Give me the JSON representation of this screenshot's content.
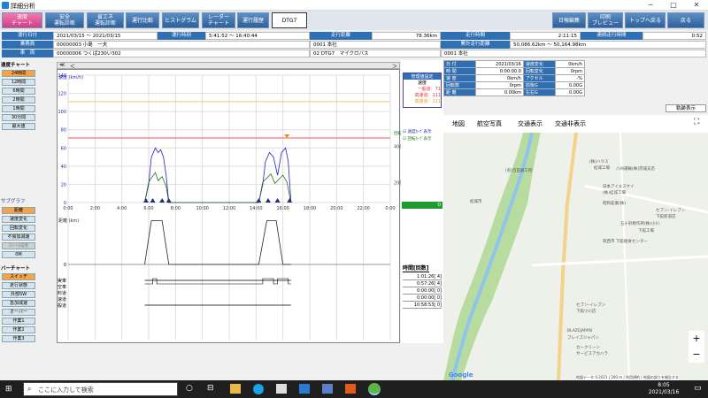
{
  "window": {
    "title": "詳細分析",
    "min": "─",
    "max": "□",
    "close": "✕"
  },
  "toolbar": {
    "left": [
      {
        "label": "速度\nチャート",
        "key": "speed"
      },
      {
        "label": "安全\n運転診断",
        "key": "safety"
      },
      {
        "label": "省エネ\n運転診断",
        "key": "eco"
      },
      {
        "label": "運行比較",
        "key": "compare"
      },
      {
        "label": "ヒストグラム",
        "key": "hist"
      },
      {
        "label": "レーダー\nチャート",
        "key": "radar"
      },
      {
        "label": "運行履歴",
        "key": "history"
      },
      {
        "label": "DTG7",
        "key": "dtg7"
      }
    ],
    "right": [
      {
        "label": "日報編集"
      },
      {
        "label": "印刷\nプレビュー"
      },
      {
        "label": "トップへ戻る"
      },
      {
        "label": "戻る"
      }
    ]
  },
  "info": {
    "rows": [
      {
        "l1": "運行日付",
        "v1": "2021/03/15 ～ 2021/03/15",
        "l2": "運行時刻",
        "v2": "5:41:52 ～ 16:40:44",
        "l3": "走行距離",
        "v3": "78.36km",
        "l4": "走行時間",
        "v4": "2:11:15",
        "l5": "連続走行時間",
        "v5": "0:52"
      },
      {
        "l1": "乗務員",
        "v1": "00000003 小島　一夫",
        "v2": "0001 本社",
        "l4": "累計走行距離",
        "v4": "50,086.62km ～ 50,164.98km"
      },
      {
        "l1": "車　両",
        "v1": "00000006 つくば230い302",
        "v2": "02 DTG7　マイクロバス",
        "v4": "0001 本社"
      }
    ]
  },
  "side": {
    "header1": "速度チャート",
    "items1": [
      "24時間",
      "12時間",
      "6時間",
      "2時間",
      "1時間",
      "30分間",
      "最大値"
    ],
    "header2": "サブグラフ",
    "items2": [
      "距離",
      "速度変化",
      "回転変化",
      "不良加減速",
      "ｽﾛｯﾄﾙ開度",
      "0M"
    ],
    "header3": "バーチャート",
    "items3": [
      "スイッチ",
      "走行状態",
      "外部SW",
      "急加減速",
      "オーバー",
      "作業1",
      "作業2",
      "作業3"
    ]
  },
  "chart_header": {
    "left1": "≪",
    "left2": "＜",
    "right": "＞"
  },
  "chart_data": {
    "type": "line",
    "title": "",
    "ylabel": "速度\n(km/h)",
    "yticks": [
      "140",
      "120",
      "100",
      "80",
      "60",
      "40",
      "20",
      "0"
    ],
    "ylim": [
      0,
      140
    ],
    "y2label": "回転数\n(rpm)",
    "y2ticks": [
      "4000",
      "2000"
    ],
    "xticks": [
      "0:00",
      "2:00",
      "4:00",
      "6:00",
      "8:00",
      "10:00",
      "12:00",
      "14:00",
      "16:00",
      "18:00",
      "20:00",
      "22:00",
      "0:00"
    ],
    "limit_lines": [
      {
        "name": "高速道",
        "value": 111,
        "color": "#f2c870"
      },
      {
        "name": "一般道",
        "value": 71,
        "color": "#ff5555"
      }
    ],
    "series": [
      {
        "name": "速度",
        "color": "#2020c0",
        "x": [
          5.7,
          6.0,
          6.2,
          6.5,
          6.7,
          6.9,
          7.1,
          7.3,
          7.5,
          14.2,
          14.5,
          14.7,
          15.0,
          15.3,
          15.6,
          15.9,
          16.2,
          16.4,
          16.6
        ],
        "y": [
          0,
          20,
          50,
          60,
          55,
          58,
          50,
          30,
          0,
          0,
          20,
          45,
          55,
          50,
          30,
          55,
          60,
          45,
          0
        ]
      },
      {
        "name": "回転数",
        "color": "#207020",
        "x": [
          5.7,
          6.0,
          6.2,
          6.5,
          6.7,
          7.0,
          7.3,
          7.5,
          14.2,
          14.5,
          14.8,
          15.1,
          15.4,
          15.7,
          16.0,
          16.3,
          16.6
        ],
        "y": [
          0,
          1500,
          1800,
          2200,
          1600,
          1900,
          1200,
          0,
          0,
          1500,
          1800,
          2100,
          1400,
          1700,
          2000,
          1500,
          0
        ]
      }
    ],
    "dist_ylabel": "距離\n(km)",
    "dist_zero": "0",
    "dist_series": {
      "x": [
        5.7,
        6.2,
        7.0,
        7.5,
        14.2,
        14.8,
        15.5,
        16.0,
        16.6
      ],
      "y": [
        0,
        90,
        90,
        0,
        0,
        90,
        90,
        0,
        0
      ]
    },
    "bar_labels": [
      "実車",
      "空車",
      "有料道",
      "高速道",
      "一般道"
    ]
  },
  "right_panel": {
    "legend": {
      "title": "管理値設定",
      "sub": "速度",
      "items": [
        "一般道：71",
        "高速道：111",
        "高速道：111"
      ]
    },
    "check1": "速度ｶｰﾌﾞ表示",
    "check2": "回転ｶｰﾌﾞ表示",
    "green_box": "0",
    "time_header": "時間[回数]",
    "time_rows": [
      "1:01:26[ 4]",
      "0:57:26[ 4]",
      "0:00:00[ 0]",
      "0:00:00[ 0]",
      "10:58:53[ 0]"
    ]
  },
  "data_table": {
    "rows": [
      [
        "日 付",
        "2021/03/16",
        "速度変化",
        "0km/h"
      ],
      [
        "時 間",
        "0:00:00.0",
        "回転変化",
        "0rpm"
      ],
      [
        "速 度",
        "0km/h",
        "アクセル",
        "-%"
      ],
      [
        "回転数",
        "0rpm",
        "前後G",
        "0.00G"
      ],
      [
        "距 離",
        "0.00km",
        "左右G",
        "0.00G"
      ]
    ],
    "track_button": "軌跡表示"
  },
  "map": {
    "tabs": [
      "地図",
      "航空写真",
      "交通表示",
      "交通非表示"
    ],
    "labels": [
      "(株)ハウス",
      "結城工場",
      "日本アイエスケイ",
      "(株)結城工場",
      "昭和産業(株)",
      "セブン-イレブン",
      "下館新道店",
      "五十鈴製作所(株)小川",
      "下館工場",
      "結城市",
      "セブン-イレブン",
      "下館小川店",
      "BLAZEJAPAN",
      "ブレイズジャパン",
      "カークリーン",
      "サービスアカハラ",
      "筑西市 下館給食センター",
      "八州運輸(株)茨城支店",
      "(有)吉田鉄工所"
    ],
    "google": "Google",
    "footer": "地図データ ©2021 | 200 m | 利用規約 | 地図の誤りを報告する",
    "zoom_in": "+",
    "zoom_out": "−"
  },
  "taskbar": {
    "search": "ここに入力して検索",
    "time": "8:05",
    "date": "2021/03/16"
  }
}
